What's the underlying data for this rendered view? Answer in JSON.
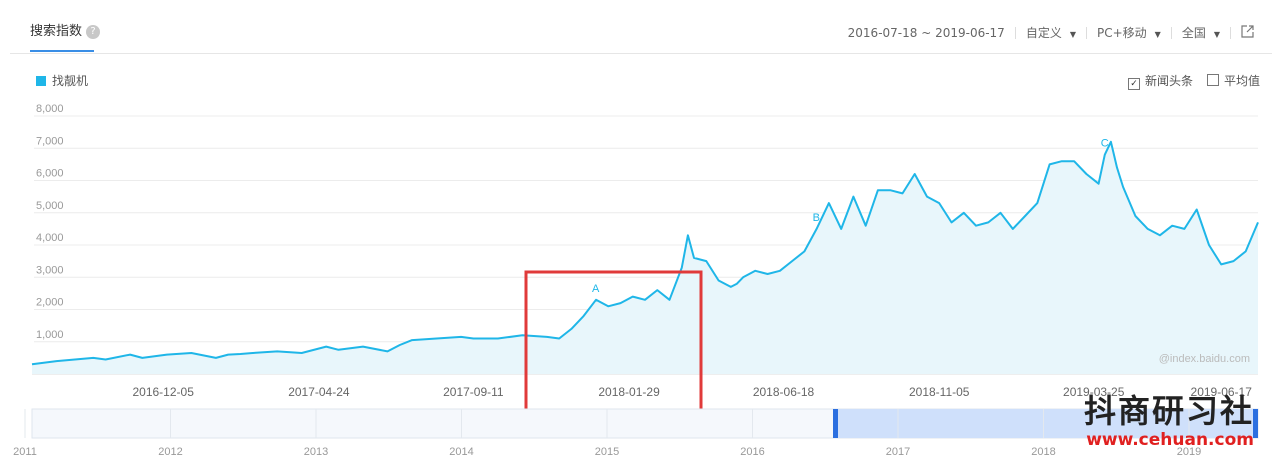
{
  "header": {
    "tab_label": "搜索指数",
    "help_icon": "?",
    "date_range": "2016-07-18 ~ 2019-06-17",
    "custom_label": "自定义",
    "device_label": "PC+移动",
    "region_label": "全国",
    "export_icon": "external-link-icon"
  },
  "legend": {
    "series_label": "找靓机",
    "color": "#1fb6e8"
  },
  "options": {
    "news_label": "新闻头条",
    "news_checked": true,
    "avg_label": "平均值",
    "avg_checked": false
  },
  "source_text": "@index.baidu.com",
  "watermark": {
    "brand": "抖商研习社",
    "url": "www.cehuan.com"
  },
  "chart_data": {
    "type": "area",
    "ylim": [
      0,
      8000
    ],
    "yticks": [
      "8,000",
      "7,000",
      "6,000",
      "5,000",
      "4,000",
      "3,000",
      "2,000",
      "1,000"
    ],
    "ytick_values": [
      8000,
      7000,
      6000,
      5000,
      4000,
      3000,
      2000,
      1000
    ],
    "xtick_labels": [
      "2016-12-05",
      "2017-04-24",
      "2017-09-11",
      "2018-01-29",
      "2018-06-18",
      "2018-11-05",
      "2019-03-25",
      "2019-06-17"
    ],
    "xtick_t": [
      0.107,
      0.234,
      0.36,
      0.487,
      0.613,
      0.74,
      0.866,
      0.97
    ],
    "series": [
      {
        "t": [
          0,
          0.02,
          0.05,
          0.06,
          0.08,
          0.09,
          0.1,
          0.11,
          0.13,
          0.15,
          0.16,
          0.17,
          0.18,
          0.2,
          0.22,
          0.24,
          0.25,
          0.27,
          0.29,
          0.3,
          0.31,
          0.33,
          0.35,
          0.36,
          0.38,
          0.4,
          0.42,
          0.43,
          0.44,
          0.45,
          0.46,
          0.47,
          0.48,
          0.49,
          0.5,
          0.51,
          0.52,
          0.53,
          0.535,
          0.54,
          0.55,
          0.56,
          0.57,
          0.575,
          0.58,
          0.59,
          0.6,
          0.61,
          0.62,
          0.63,
          0.64,
          0.65,
          0.66,
          0.67,
          0.68,
          0.69,
          0.7,
          0.71,
          0.72,
          0.73,
          0.74,
          0.75,
          0.76,
          0.77,
          0.78,
          0.79,
          0.8,
          0.81,
          0.82,
          0.83,
          0.84,
          0.85,
          0.86,
          0.87,
          0.875,
          0.88,
          0.885,
          0.89,
          0.9,
          0.91,
          0.92,
          0.93,
          0.94,
          0.95,
          0.96,
          0.97,
          0.98,
          0.99,
          1.0
        ],
        "values": [
          300,
          400,
          500,
          450,
          600,
          500,
          550,
          600,
          650,
          500,
          600,
          620,
          650,
          700,
          650,
          850,
          750,
          850,
          700,
          900,
          1050,
          1100,
          1150,
          1100,
          1100,
          1200,
          1150,
          1100,
          1400,
          1800,
          2300,
          2100,
          2200,
          2400,
          2300,
          2600,
          2300,
          3300,
          4300,
          3600,
          3500,
          2900,
          2700,
          2800,
          3000,
          3200,
          3100,
          3200,
          3500,
          3800,
          4500,
          5300,
          4500,
          5500,
          4600,
          5700,
          5700,
          5600,
          6200,
          5500,
          5300,
          4700,
          5000,
          4600,
          4700,
          5000,
          4500,
          4900,
          5300,
          6500,
          6600,
          6600,
          6200,
          5900,
          6800,
          7200,
          6400,
          5800,
          4900,
          4500,
          4300,
          4600,
          4500,
          5100,
          4000,
          3400,
          3500,
          3800,
          4700
        ]
      }
    ],
    "annotations": [
      {
        "label": "A",
        "value": 2300,
        "t_index": 30
      },
      {
        "label": "B",
        "value": 4500,
        "t_index": 50
      },
      {
        "label": "C",
        "value": 6800,
        "t_index": 74
      }
    ],
    "navigator_years": [
      "2011",
      "2012",
      "2013",
      "2014",
      "2015",
      "2016",
      "2017",
      "2018",
      "2019"
    ]
  }
}
